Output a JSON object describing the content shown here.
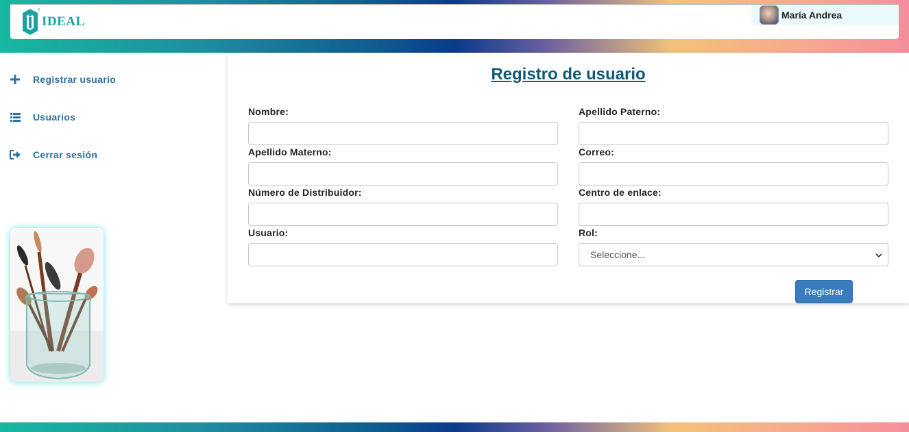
{
  "brand": {
    "name": "IDEAL"
  },
  "user": {
    "name": "María Andrea"
  },
  "sidebar": {
    "items": [
      {
        "label": "Registrar usuario",
        "icon": "plus-icon"
      },
      {
        "label": "Usuarios",
        "icon": "list-icon"
      },
      {
        "label": "Cerrar sesión",
        "icon": "sign-out-icon"
      }
    ],
    "promo_image": "makeup-brushes-jar"
  },
  "form": {
    "title": "Registro de usuario",
    "fields": {
      "nombre": {
        "label": "Nombre:",
        "value": ""
      },
      "apellido_paterno": {
        "label": "Apellido Paterno:",
        "value": ""
      },
      "apellido_materno": {
        "label": "Apellido Materno:",
        "value": ""
      },
      "correo": {
        "label": "Correo:",
        "value": ""
      },
      "numero_distribuidor": {
        "label": "Número de Distribuidor:",
        "value": ""
      },
      "centro_enlace": {
        "label": "Centro de enlace:",
        "value": ""
      },
      "usuario": {
        "label": "Usuario:",
        "value": ""
      },
      "rol": {
        "label": "Rol:",
        "selected": "Seleccione..."
      }
    },
    "submit_label": "Registrar"
  },
  "colors": {
    "accent": "#2d6fa0",
    "button": "#3a7bbd",
    "title": "#115a75",
    "brand_teal": "#1aa3a0"
  }
}
